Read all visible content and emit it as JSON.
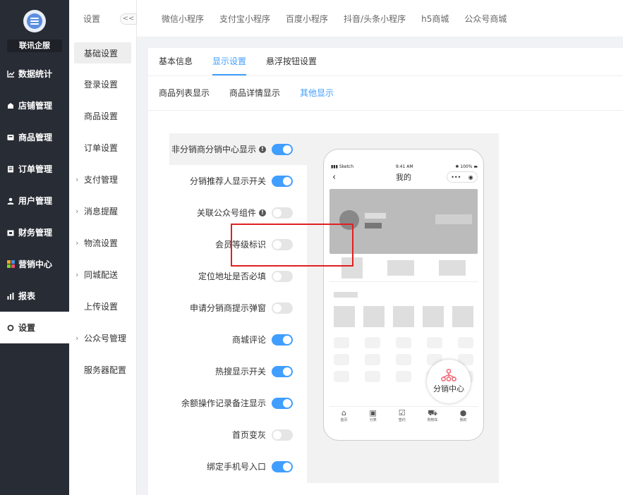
{
  "nav": {
    "brand": "联讯企服",
    "items": [
      {
        "label": "数据统计",
        "icon": "chart-line-icon"
      },
      {
        "label": "店铺管理",
        "icon": "store-icon"
      },
      {
        "label": "商品管理",
        "icon": "goods-icon"
      },
      {
        "label": "订单管理",
        "icon": "order-icon"
      },
      {
        "label": "用户管理",
        "icon": "user-icon"
      },
      {
        "label": "财务管理",
        "icon": "finance-icon"
      },
      {
        "label": "营销中心",
        "icon": "marketing-icon"
      },
      {
        "label": "报表",
        "icon": "report-icon"
      },
      {
        "label": "设置",
        "icon": "settings-icon"
      }
    ]
  },
  "subnav": {
    "title": "设置",
    "collapse": "<<",
    "items": [
      {
        "label": "基础设置"
      },
      {
        "label": "登录设置"
      },
      {
        "label": "商品设置"
      },
      {
        "label": "订单设置"
      },
      {
        "label": "支付管理",
        "expandable": true
      },
      {
        "label": "消息提醒",
        "expandable": true
      },
      {
        "label": "物流设置",
        "expandable": true
      },
      {
        "label": "同城配送",
        "expandable": true
      },
      {
        "label": "上传设置"
      },
      {
        "label": "公众号管理",
        "expandable": true
      },
      {
        "label": "服务器配置"
      }
    ]
  },
  "toptabs": [
    "微信小程序",
    "支付宝小程序",
    "百度小程序",
    "抖音/头条小程序",
    "h5商城",
    "公众号商城"
  ],
  "tabs1": [
    "基本信息",
    "显示设置",
    "悬浮按钮设置"
  ],
  "tabs2": [
    "商品列表显示",
    "商品详情显示",
    "其他显示"
  ],
  "settings": [
    {
      "label": "非分销商分销中心显示",
      "info": true,
      "on": true
    },
    {
      "label": "分销推荐人显示开关",
      "on": true
    },
    {
      "label": "关联公众号组件",
      "info": true,
      "on": false
    },
    {
      "label": "会员等级标识",
      "on": false
    },
    {
      "label": "定位地址是否必填",
      "on": false
    },
    {
      "label": "申请分销商提示弹窗",
      "on": false
    },
    {
      "label": "商城评论",
      "on": true
    },
    {
      "label": "热搜显示开关",
      "on": true
    },
    {
      "label": "余额操作记录备注显示",
      "on": true
    },
    {
      "label": "首页变灰",
      "on": false
    },
    {
      "label": "绑定手机号入口",
      "on": true
    }
  ],
  "phone": {
    "carrier": "Sketch",
    "time": "9:41 AM",
    "battery": "100%",
    "title": "我的",
    "float_label": "分销中心",
    "tabbar": [
      "首页",
      "分类",
      "签约",
      "购物车",
      "我的"
    ]
  },
  "colors": {
    "accent": "#409eff",
    "highlight": "#e02020",
    "nav_bg": "#282c34"
  }
}
